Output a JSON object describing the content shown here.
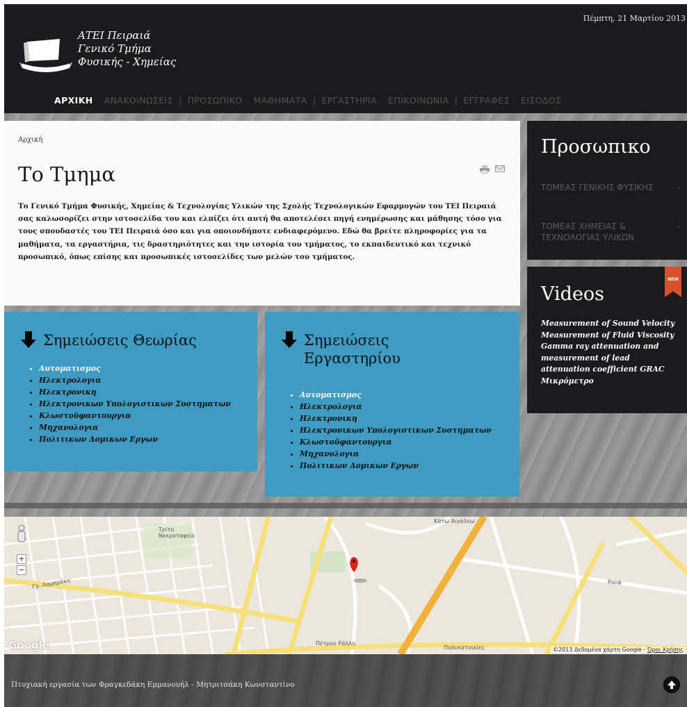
{
  "header": {
    "date": "Πέμπτη, 21 Μαρτίου 2013",
    "logo_lines": [
      "ΑΤΕΙ Πειραιά",
      "Γενικό Τμήμα",
      "Φυσικής - Χημείας"
    ]
  },
  "nav": {
    "items": [
      "ΑΡΧΙΚΗ",
      "ΑΝΑΚΟΙΝΩΣΕΙΣ",
      "ΠΡΟΣΩΠΙΚΟ",
      "ΜΑΘΗΜΑΤΑ",
      "ΕΡΓΑΣΤΗΡΙΑ",
      "ΕΠΙΚΟΙΝΩΝΙΑ",
      "ΕΓΓΡΑΦΕΣ",
      "ΕΙΣΟΔΟΣ"
    ],
    "active": "ΑΡΧΙΚΗ"
  },
  "main": {
    "breadcrumb": "Αρχική",
    "title": "Το Τμημα",
    "intro": "Το Γενικό Τμήμα Φυσικής, Χημείας & Τεχνολογίας Υλικών της Σχολής Τεχνολογικών Εφαρμογών του ΤΕΙ Πειραιά σας καλωσορίζει στην ιστοσελίδα του και ελπίζει ότι αυτή θα αποτελέσει πηγή ενημέρωσης και μάθησης τόσο για τους σπουδαστές του ΤΕΙ Πειραιά όσο και για οποιονδήποτε ενδιαφερόμενο. Εδώ θα βρείτε πληροφορίες για τα μαθήματα, τα εργαστήρια, τις δραστηριότητες και την ιστορία του τμήματος, το εκπαιδευτικό και τεχνικό προσωπικό, όπως επίσης και προσωπικές ιστοσελίδες των μελών του τμήματος."
  },
  "staff": {
    "title": "Προσωπικο",
    "items": [
      {
        "label": "ΤΟΜΕΑΣ ΓΕΝΙΚΗΣ ΦΥΣΙΚΗΣ",
        "toggle": "-"
      },
      {
        "label": "ΤΟΜΕΑΣ ΧΗΜΕΙΑΣ & ΤΕΧΝΟΛΟΓΙΑΣ ΥΛΙΚΩΝ",
        "toggle": "-"
      }
    ]
  },
  "videos": {
    "title": "Videos",
    "badge": "NEW",
    "links": [
      "Measurement of Sound Velocity",
      "Measurement of Fluid Viscosity",
      "Gamma ray attenuation and measurement of lead attenuation coefficient GRAC",
      "Μικρόμετρο"
    ]
  },
  "theory": {
    "title": "Σημειώσεις Θεωρίας",
    "items": [
      "Αυτοματισμος",
      "Ηλεκτρολογια",
      "Ηλεκτρονικη",
      "Ηλεκτρονικων Υπολογιστικων Συστηματων",
      "Κλωστοϋφαντουργια",
      "Μηχανολογια",
      "Πολιτικων Δομικων Εργων"
    ]
  },
  "lab": {
    "title_line1": "Σημειώσεις",
    "title_line2": "Εργαστηρίου",
    "items": [
      "Αυτοματισμος",
      "Ηλεκτρολογια",
      "Ηλεκτρονικη",
      "Ηλεκτρονικων Υπολογιστικων Συστηματων",
      "Κλωστοϋφαντουργια",
      "Μηχανολογια",
      "Πολιτικων Δομικων Εργων"
    ]
  },
  "map": {
    "labels": {
      "cemetery": "Τρίτο Νεκροταφείο",
      "neighborhood": "Κάτω Αιγάλεω",
      "rouf": "Ρουφ",
      "street1": "Γρ. Λαμπράκη",
      "street2": "Πέτρου Ράλλη",
      "polytechnic": "Πολυκατοικίες"
    },
    "logo": "Google",
    "copyright": "©2013 Δεδομένα χάρτη Google -",
    "terms": "Όροι Χρήσης"
  },
  "footer": {
    "text": "Πτυχιακή εργασία των Φραγκεδάκη Εμμανουήλ - Μητριτσάκη Κωνσταντίνο"
  },
  "colors": {
    "header_bg": "#1b1a1c",
    "accent_blue": "#3f9bc1",
    "badge_red": "#d6502a",
    "nav_inactive": "#545454"
  }
}
